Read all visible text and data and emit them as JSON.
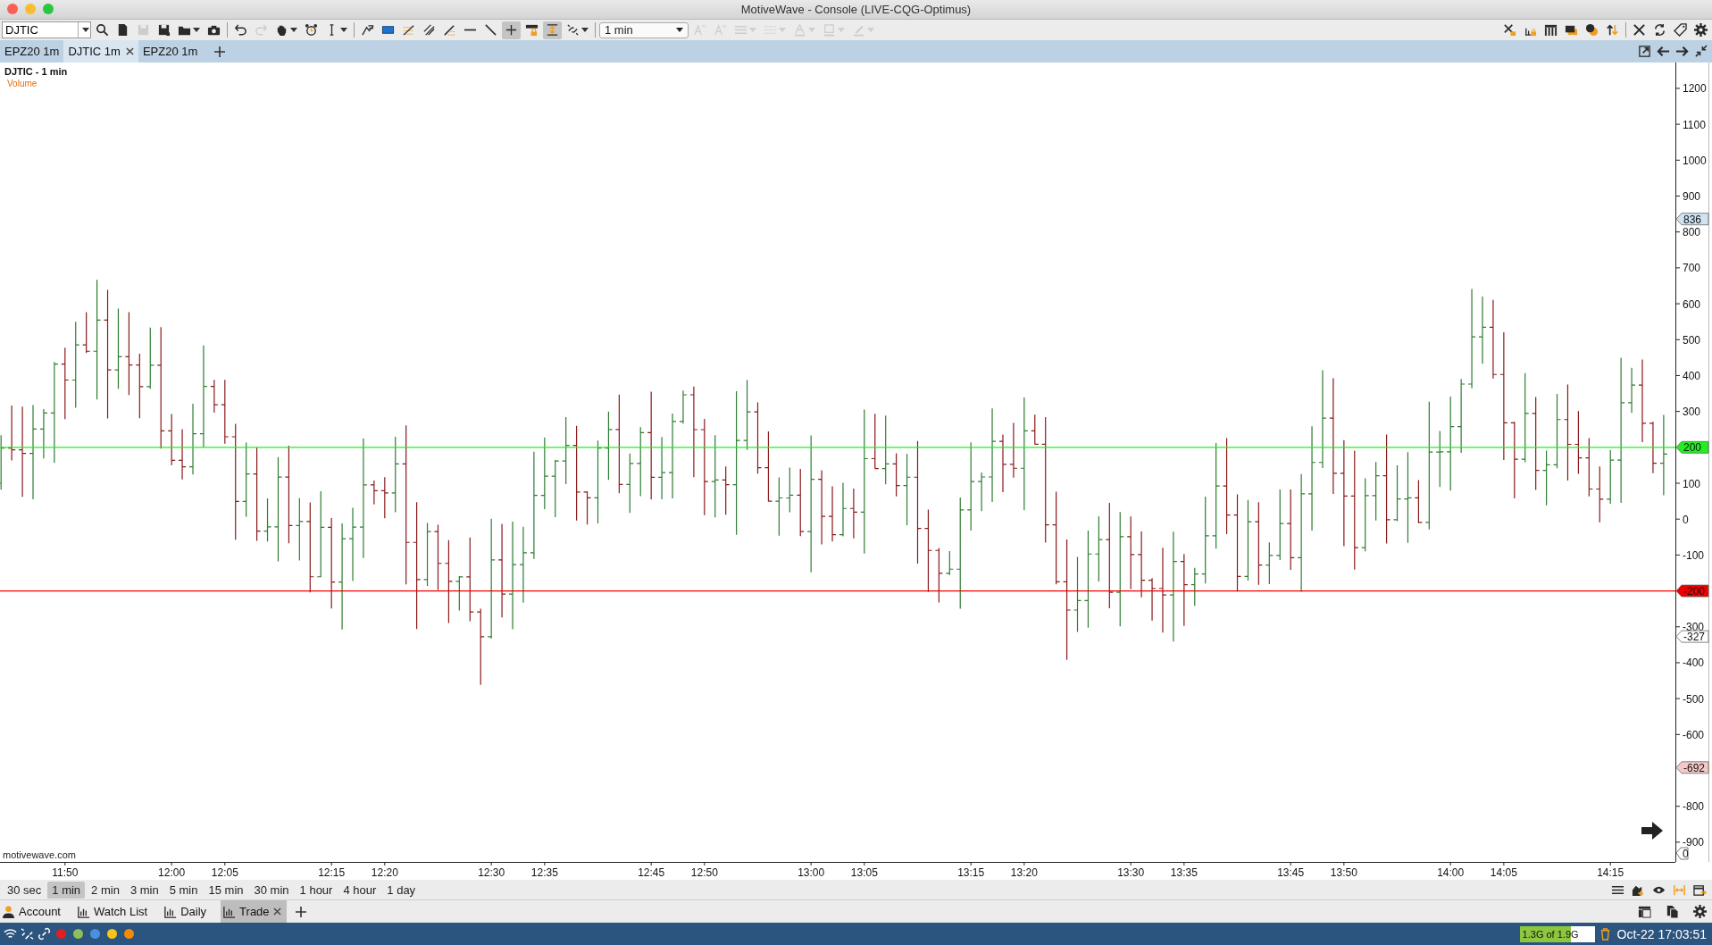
{
  "window": {
    "title": "MotiveWave - Console (LIVE-CQG-Optimus)"
  },
  "toolbar": {
    "symbol": "DJTIC",
    "interval": "1 min",
    "left_tools": [
      {
        "kind": "search",
        "selected": false,
        "disabled": false
      },
      {
        "kind": "file",
        "selected": false,
        "disabled": false
      },
      {
        "kind": "save",
        "selected": false,
        "disabled": true
      },
      {
        "kind": "saveas",
        "selected": false,
        "disabled": false
      },
      {
        "kind": "folder",
        "selected": false,
        "disabled": false,
        "menu": true
      },
      {
        "kind": "camera",
        "selected": false,
        "disabled": false
      },
      {
        "kind": "undo",
        "selected": false,
        "disabled": false
      },
      {
        "kind": "redo",
        "selected": false,
        "disabled": true
      },
      {
        "kind": "hand",
        "selected": false,
        "disabled": false,
        "menu": true
      },
      {
        "kind": "alarm",
        "selected": false,
        "disabled": false
      },
      {
        "kind": "cursor",
        "selected": false,
        "disabled": false,
        "menu": true
      },
      {
        "kind": "trendlines",
        "selected": false,
        "disabled": false
      },
      {
        "kind": "rectangle",
        "selected": false,
        "disabled": false
      },
      {
        "kind": "fibonacci",
        "selected": false,
        "disabled": false
      },
      {
        "kind": "channel",
        "selected": false,
        "disabled": false
      },
      {
        "kind": "ray",
        "selected": false,
        "disabled": false
      },
      {
        "kind": "hline",
        "selected": false,
        "disabled": false
      },
      {
        "kind": "line",
        "selected": false,
        "disabled": false
      },
      {
        "kind": "crosshair",
        "selected": true,
        "disabled": false
      },
      {
        "kind": "lock",
        "selected": false,
        "disabled": false
      },
      {
        "kind": "scale",
        "selected": true,
        "disabled": false
      },
      {
        "kind": "link",
        "selected": false,
        "disabled": false,
        "menu": true
      }
    ],
    "format_tools": [
      {
        "kind": "fontup",
        "disabled": true
      },
      {
        "kind": "fontdown",
        "disabled": true
      },
      {
        "kind": "lines",
        "disabled": true,
        "menu": true
      },
      {
        "kind": "list",
        "disabled": true,
        "menu": true
      },
      {
        "kind": "textcolor",
        "disabled": true,
        "menu": true
      },
      {
        "kind": "fill",
        "disabled": true,
        "menu": true
      },
      {
        "kind": "pen",
        "disabled": true,
        "menu": true
      }
    ],
    "right_tools": [
      {
        "kind": "toolslock"
      },
      {
        "kind": "barslock"
      },
      {
        "kind": "columns"
      },
      {
        "kind": "windows"
      },
      {
        "kind": "circles"
      },
      {
        "kind": "updown"
      },
      {
        "kind": "tools"
      },
      {
        "kind": "sync"
      },
      {
        "kind": "tag"
      },
      {
        "kind": "gear"
      }
    ]
  },
  "tabs": [
    {
      "label": "EPZ20 1m",
      "selected": false,
      "closable": false
    },
    {
      "label": "DJTIC 1m",
      "selected": true,
      "closable": true
    },
    {
      "label": "EPZ20 1m",
      "selected": false,
      "closable": false
    }
  ],
  "tab_tools": [
    {
      "kind": "popout"
    },
    {
      "kind": "back"
    },
    {
      "kind": "forward"
    },
    {
      "kind": "collapse"
    }
  ],
  "chart": {
    "title": "DJTIC - 1 min",
    "study": "Volume",
    "footer": "motivewave.com",
    "volume_marker": "0",
    "yticks": [
      "1200",
      "1100",
      "1000",
      "900",
      "800",
      "700",
      "600",
      "500",
      "400",
      "300",
      "100",
      "0",
      "-100",
      "-300",
      "-400",
      "-500",
      "-600",
      "-800",
      "-900"
    ],
    "xticks": [
      "11:50",
      "12:00",
      "12:05",
      "12:15",
      "12:20",
      "12:30",
      "12:35",
      "12:45",
      "12:50",
      "13:00",
      "13:05",
      "13:15",
      "13:20",
      "13:30",
      "13:35",
      "13:45",
      "13:50",
      "14:00",
      "14:05",
      "14:15"
    ],
    "markers": [
      {
        "label": "836",
        "color": "#cfe3f3"
      },
      {
        "label": "200",
        "color": "#22ee22",
        "line": true
      },
      {
        "label": "-200",
        "color": "#ee0000",
        "line": true
      },
      {
        "label": "-327"
      },
      {
        "label": "-692",
        "color": "#f6c9c9"
      }
    ]
  },
  "bar_sizes": [
    {
      "label": "30 sec",
      "selected": false
    },
    {
      "label": "1 min",
      "selected": true
    },
    {
      "label": "2 min",
      "selected": false
    },
    {
      "label": "3 min",
      "selected": false
    },
    {
      "label": "5 min",
      "selected": false
    },
    {
      "label": "15 min",
      "selected": false
    },
    {
      "label": "30 min",
      "selected": false
    },
    {
      "label": "1 hour",
      "selected": false
    },
    {
      "label": "4 hour",
      "selected": false
    },
    {
      "label": "1 day",
      "selected": false
    }
  ],
  "bar_tools": [
    {
      "kind": "menu"
    },
    {
      "kind": "chartadd"
    },
    {
      "kind": "eye"
    },
    {
      "kind": "fit"
    },
    {
      "kind": "calendar"
    }
  ],
  "panel_tabs": [
    {
      "label": "Account",
      "kind": "person",
      "selected": false,
      "closable": false
    },
    {
      "label": "Watch List",
      "kind": "bars",
      "selected": false,
      "closable": false
    },
    {
      "label": "Daily",
      "kind": "bars",
      "selected": false,
      "closable": false
    },
    {
      "label": "Trade",
      "kind": "bars",
      "selected": true,
      "closable": true
    }
  ],
  "panel_tools": [
    {
      "kind": "layout"
    },
    {
      "kind": "copy"
    },
    {
      "kind": "gear"
    }
  ],
  "status_bar": {
    "dots": [
      {
        "color": "#e02020"
      },
      {
        "color": "#8fbf5a"
      },
      {
        "color": "#4a90e2"
      },
      {
        "color": "#f5c518"
      },
      {
        "color": "#f58a07"
      }
    ],
    "memory": {
      "text": "1.3G of 1.9G",
      "level": 0.68
    },
    "datetime": "Oct-22 17:03:51"
  }
}
